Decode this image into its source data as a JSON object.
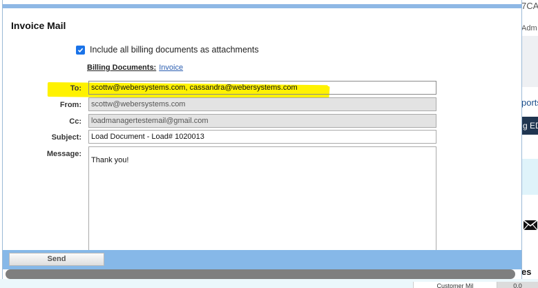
{
  "background": {
    "top_right_text": "7CA",
    "user_text": "Adm",
    "reports_text": "ports",
    "edi_text": "g EDI",
    "bottom_text": "es",
    "tab_label": "Customer Mil",
    "tab2_label": "0.0"
  },
  "modal": {
    "title": "Invoice Mail",
    "attach_label": "Include all billing documents as attachments",
    "attach_checked": true,
    "billing_label": "Billing Documents:",
    "billing_link": "Invoice",
    "fields": {
      "to": {
        "label": "To:",
        "value": "scottw@webersystems.com, cassandra@webersystems.com"
      },
      "from": {
        "label": "From:",
        "value": "scottw@webersystems.com"
      },
      "cc": {
        "label": "Cc:",
        "value": "loadmanagertestemail@gmail.com"
      },
      "subject": {
        "label": "Subject:",
        "value": "Load Document - Load# 1020013"
      },
      "message": {
        "label": "Message:",
        "value": "Thank you!"
      }
    },
    "send_label": "Send"
  },
  "colors": {
    "accent_bar": "#86b8e8",
    "highlight": "#fff200",
    "link": "#2a5db0"
  }
}
